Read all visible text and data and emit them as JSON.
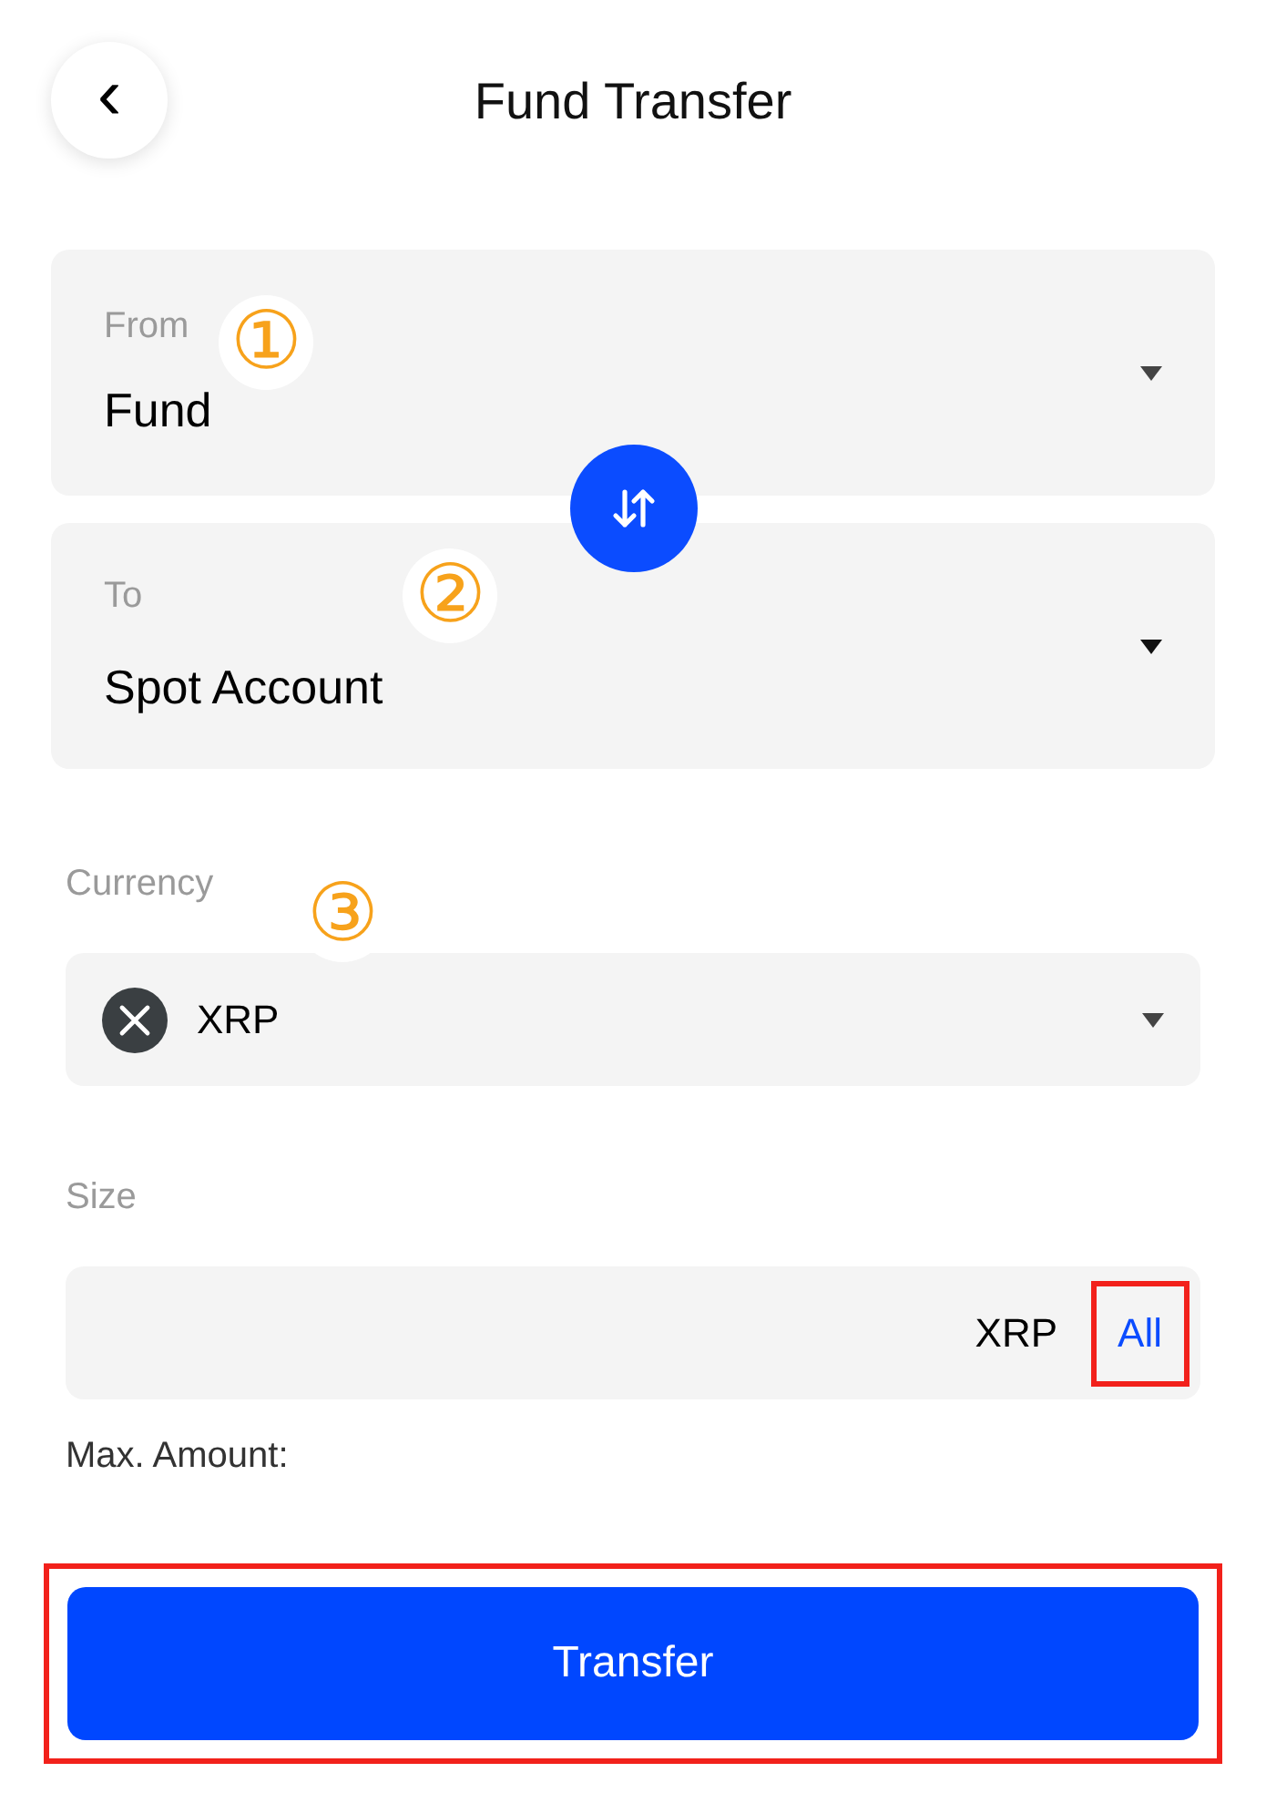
{
  "header": {
    "back": "‹",
    "title": "Fund Transfer"
  },
  "from": {
    "label": "From",
    "value": "Fund",
    "marker": "①"
  },
  "to": {
    "label": "To",
    "value": "Spot Account",
    "marker": "②"
  },
  "currency": {
    "label": "Currency",
    "value": "XRP",
    "marker": "③"
  },
  "size": {
    "label": "Size",
    "unit": "XRP",
    "all": "All",
    "all_highlighted": true
  },
  "max_amount": "Max. Amount:",
  "transfer": {
    "label": "Transfer",
    "highlighted": true
  }
}
